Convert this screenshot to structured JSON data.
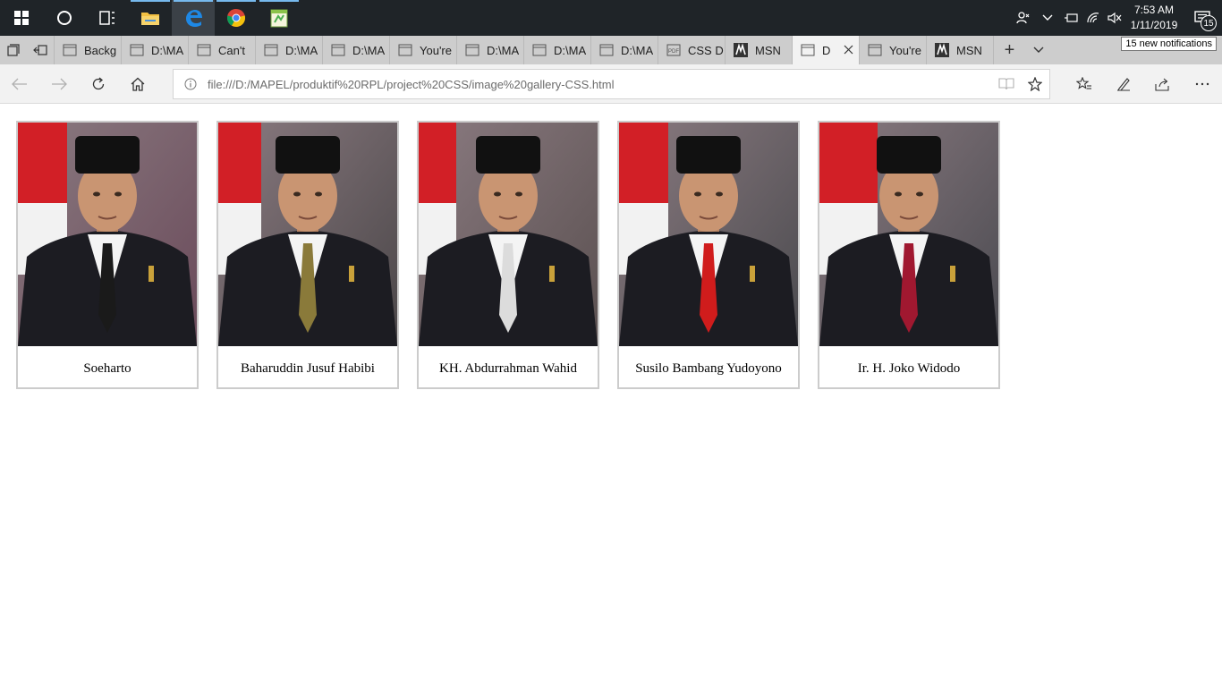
{
  "taskbar": {
    "apps": [
      "start",
      "cortana",
      "task-view",
      "file-explorer",
      "edge",
      "chrome",
      "notepad-plus"
    ],
    "clock": {
      "time": "7:53 AM",
      "date": "1/11/2019"
    },
    "notification_count": "15"
  },
  "tooltip": "15 new notifications",
  "tabs": [
    {
      "label": "Backg",
      "icon": "page-icon"
    },
    {
      "label": "D:\\MA",
      "icon": "page-icon"
    },
    {
      "label": "Can't",
      "icon": "page-icon"
    },
    {
      "label": "D:\\MA",
      "icon": "page-icon"
    },
    {
      "label": "D:\\MA",
      "icon": "page-icon"
    },
    {
      "label": "You're",
      "icon": "page-icon"
    },
    {
      "label": "D:\\MA",
      "icon": "page-icon"
    },
    {
      "label": "D:\\MA",
      "icon": "page-icon"
    },
    {
      "label": "D:\\MA",
      "icon": "page-icon"
    },
    {
      "label": "CSS D",
      "icon": "pdf-icon"
    },
    {
      "label": "MSN",
      "icon": "msn-icon"
    },
    {
      "label": "D",
      "icon": "page-icon",
      "active": true
    },
    {
      "label": "You're",
      "icon": "page-icon"
    },
    {
      "label": "MSN",
      "icon": "msn-icon"
    }
  ],
  "address": {
    "url": "file:///D:/MAPEL/produktif%20RPL/project%20CSS/image%20gallery-CSS.html"
  },
  "gallery": [
    {
      "caption": "Soeharto",
      "tie": "#1a1a1a",
      "flag": true
    },
    {
      "caption": "Baharuddin Jusuf Habibi",
      "tie": "#8a7a3a",
      "flag": true
    },
    {
      "caption": "KH. Abdurrahman Wahid",
      "tie": "#dcdcdc",
      "flag": true
    },
    {
      "caption": "Susilo Bambang Yudoyono",
      "tie": "#d01c1c",
      "flag": true
    },
    {
      "caption": "Ir. H. Joko Widodo",
      "tie": "#a01830",
      "flag": true
    }
  ],
  "colors": {
    "taskbar_bg": "#1f2428",
    "tabstrip_bg": "#cdcdcd",
    "active_tab_bg": "#f2f2f2",
    "card_border": "#cccccc",
    "flag_red": "#d21f26"
  }
}
